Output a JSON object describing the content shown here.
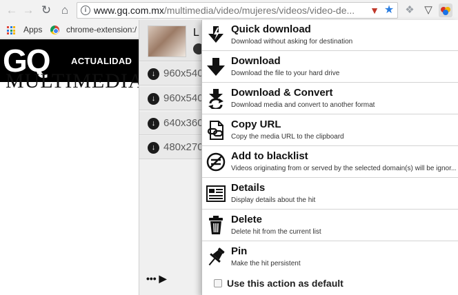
{
  "browser": {
    "url_host": "www.gq.com.mx",
    "url_path": "/multimedia/video/mujeres/videos/video-de...",
    "info_icon": "i",
    "bookmarks": [
      {
        "label": "Apps"
      },
      {
        "label": "chrome-extension:/"
      }
    ]
  },
  "page": {
    "logo": "GQ",
    "nav_item": "ACTUALIDAD",
    "headline": "MULTIMEDIA"
  },
  "hits_panel": {
    "hit_title": "L",
    "variants": [
      {
        "label": "960x540"
      },
      {
        "label": "960x540"
      },
      {
        "label": "640x360"
      },
      {
        "label": "480x270"
      }
    ],
    "more_label": "••• ▶"
  },
  "action_menu": {
    "items": [
      {
        "title": "Quick download",
        "desc": "Download without asking for destination",
        "icon": "quick-download-icon"
      },
      {
        "title": "Download",
        "desc": "Download the file to your hard drive",
        "icon": "download-icon"
      },
      {
        "title": "Download & Convert",
        "desc": "Download media and convert to another format",
        "icon": "download-convert-icon"
      },
      {
        "title": "Copy URL",
        "desc": "Copy the media URL to the clipboard",
        "icon": "copy-url-icon"
      },
      {
        "title": "Add to blacklist",
        "desc": "Videos originating from or served by the selected domain(s) will be ignor...",
        "icon": "blacklist-icon"
      },
      {
        "title": "Details",
        "desc": "Display details about the hit",
        "icon": "details-icon"
      },
      {
        "title": "Delete",
        "desc": "Delete hit from the current list",
        "icon": "trash-icon"
      },
      {
        "title": "Pin",
        "desc": "Make the hit persistent",
        "icon": "pin-icon"
      }
    ],
    "default_checkbox_label": "Use this action as default",
    "default_checked": false
  }
}
